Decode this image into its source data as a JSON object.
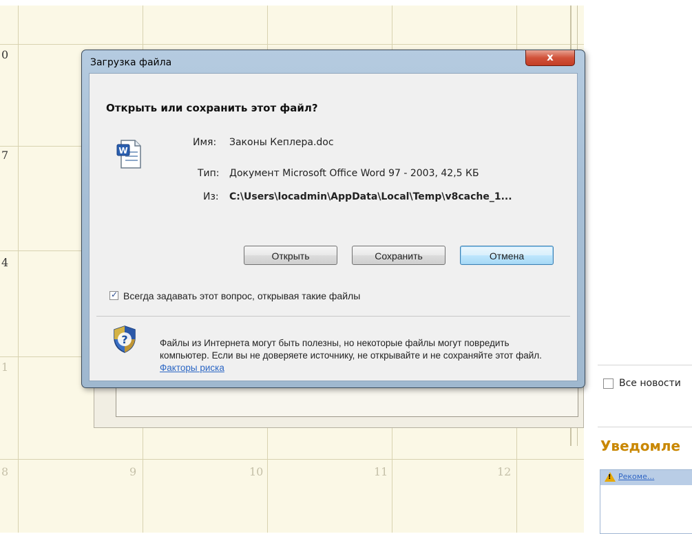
{
  "calendar": {
    "numbers": [
      "0",
      "7",
      "4",
      "1",
      "8",
      "9",
      "10",
      "11",
      "12"
    ]
  },
  "dialog": {
    "title": "Загрузка файла",
    "close_symbol": "x",
    "question": "Открыть или сохранить этот файл?",
    "name_label": "Имя:",
    "name_value": "Законы Кеплера.doc",
    "type_label": "Тип:",
    "type_value": "Документ Microsoft Office Word 97 - 2003, 42,5 КБ",
    "from_label": "Из:",
    "from_value": "C:\\Users\\locadmin\\AppData\\Local\\Temp\\v8cache_1...",
    "open_button": "Открыть",
    "save_button": "Сохранить",
    "cancel_button": "Отмена",
    "always_ask_label": "Всегда задавать этот вопрос, открывая такие файлы",
    "always_ask_checked": true,
    "warning_text": "Файлы из Интернета могут быть полезны, но некоторые файлы могут повредить компьютер. Если вы не доверяете источнику, не открывайте и не сохраняйте этот файл.",
    "risk_link": "Факторы риска",
    "file_icon": "word-document-icon",
    "shield_icon": "security-shield-question-icon"
  },
  "right_panel": {
    "news_label": "Все новости",
    "notifications_title": "Уведомле",
    "notification_link": "Рекоме...",
    "warning_icon": "warning-triangle-icon"
  }
}
